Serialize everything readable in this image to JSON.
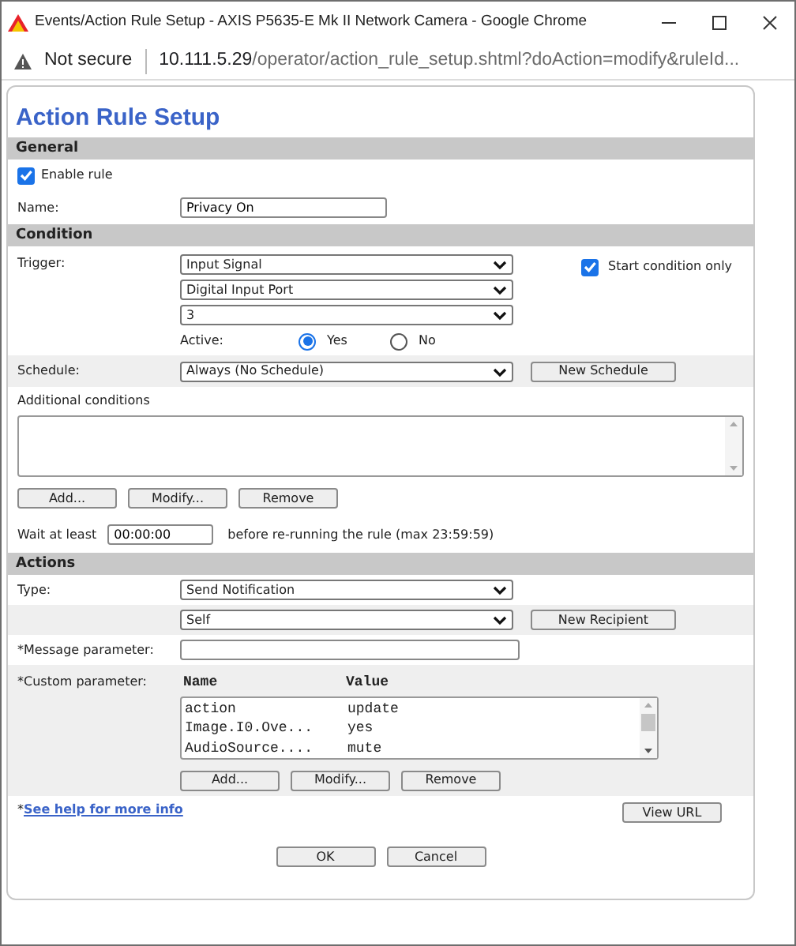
{
  "window": {
    "title": "Events/Action Rule Setup - AXIS P5635-E Mk II Network Camera - Google Chrome"
  },
  "address_bar": {
    "security": "Not secure",
    "url_host": "10.111.5.29",
    "url_path": "/operator/action_rule_setup.shtml?doAction=modify&ruleId..."
  },
  "page_title": "Action Rule Setup",
  "general": {
    "header": "General",
    "enable_rule": {
      "label": "Enable rule",
      "checked": true
    },
    "name": {
      "label": "Name:",
      "value": "Privacy On"
    }
  },
  "condition": {
    "header": "Condition",
    "trigger": {
      "label": "Trigger:",
      "selects": [
        "Input Signal",
        "Digital Input Port",
        "3"
      ],
      "start_condition_only": {
        "label": "Start condition only",
        "checked": true
      },
      "active": {
        "label": "Active:",
        "options": [
          {
            "label": "Yes",
            "selected": true
          },
          {
            "label": "No",
            "selected": false
          }
        ]
      }
    },
    "schedule": {
      "label": "Schedule:",
      "value": "Always (No Schedule)",
      "button": "New Schedule"
    },
    "additional_conditions": {
      "label": "Additional conditions",
      "buttons": [
        "Add...",
        "Modify...",
        "Remove"
      ]
    },
    "wait": {
      "label": "Wait at least",
      "value": "00:00:00",
      "note": "before re-running the rule (max 23:59:59)"
    }
  },
  "actions": {
    "header": "Actions",
    "type": {
      "label": "Type:",
      "value": "Send Notification"
    },
    "recipient": {
      "value": "Self",
      "button": "New Recipient"
    },
    "message_parameter": {
      "label": "*Message parameter:"
    },
    "custom_parameter": {
      "label": "*Custom parameter:",
      "columns": [
        "Name",
        "Value"
      ],
      "rows": [
        [
          "action",
          "update"
        ],
        [
          "Image.I0.Ove...",
          "yes"
        ],
        [
          "AudioSource....",
          "mute"
        ]
      ],
      "buttons": [
        "Add...",
        "Modify...",
        "Remove"
      ]
    }
  },
  "help": {
    "marker": "*",
    "link": "See help for more info"
  },
  "view_url_button": "View URL",
  "footer_buttons": [
    "OK",
    "Cancel"
  ]
}
